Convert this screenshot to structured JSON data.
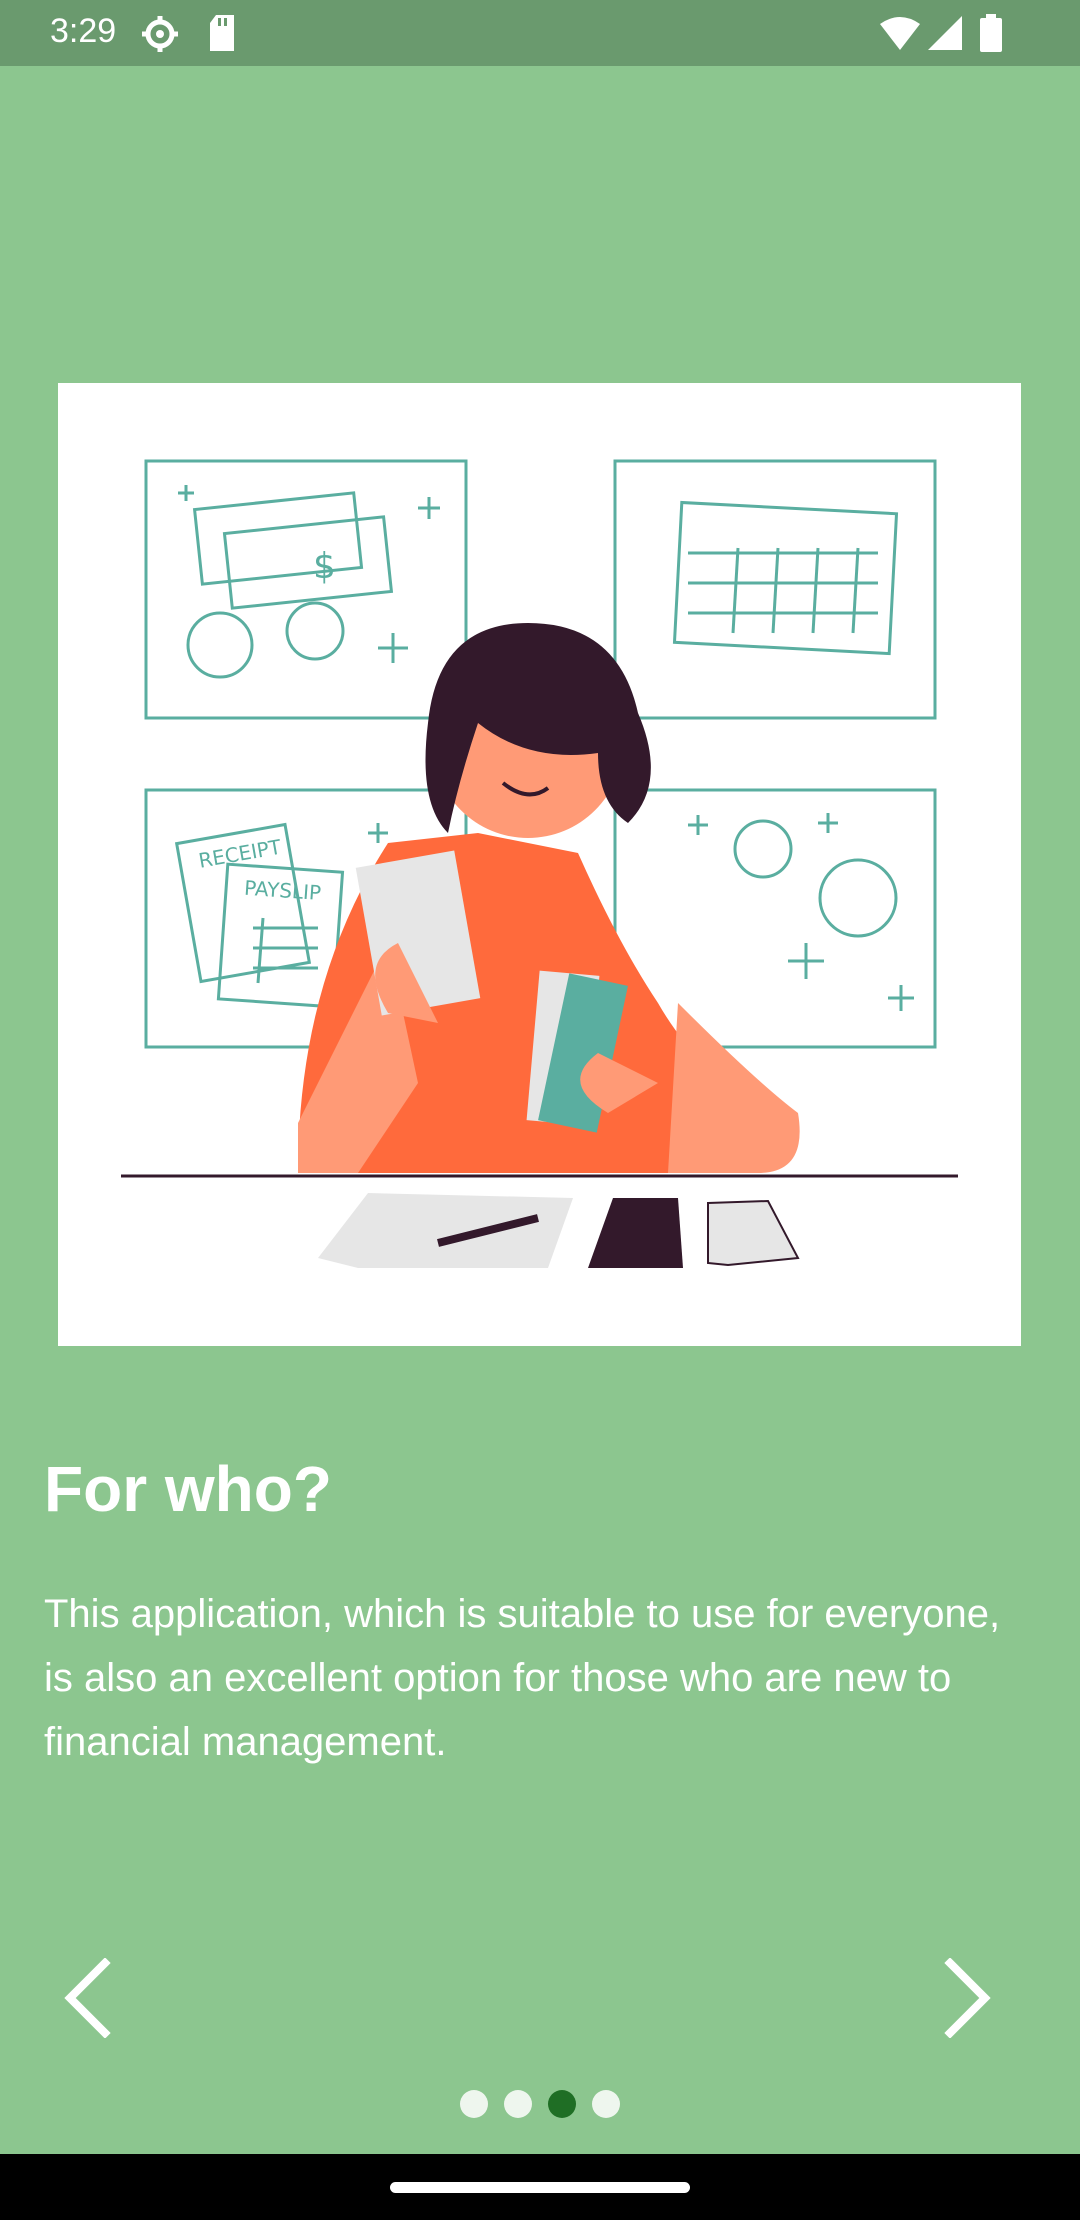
{
  "status_bar": {
    "time": "3:29",
    "icons": [
      "settings-icon",
      "sd-card-icon",
      "wifi-icon",
      "signal-icon",
      "battery-icon"
    ]
  },
  "colors": {
    "background": "#8cc68f",
    "status_bar": "#6a9a6e",
    "text": "#ffffff",
    "dot_active": "#1f6e25",
    "dot_inactive": "#eef6ee"
  },
  "illustration": {
    "name": "financial-management-illustration",
    "receipt_text": "RECEIPT",
    "payslip_text": "PAYSLIP"
  },
  "onboarding": {
    "title": "For who?",
    "description": "This application, which is suitable to use for everyone, is also an excellent option for those who are new to financial management."
  },
  "navigation": {
    "prev_icon": "chevron-left-icon",
    "next_icon": "chevron-right-icon"
  },
  "pager": {
    "total": 4,
    "current": 3
  }
}
